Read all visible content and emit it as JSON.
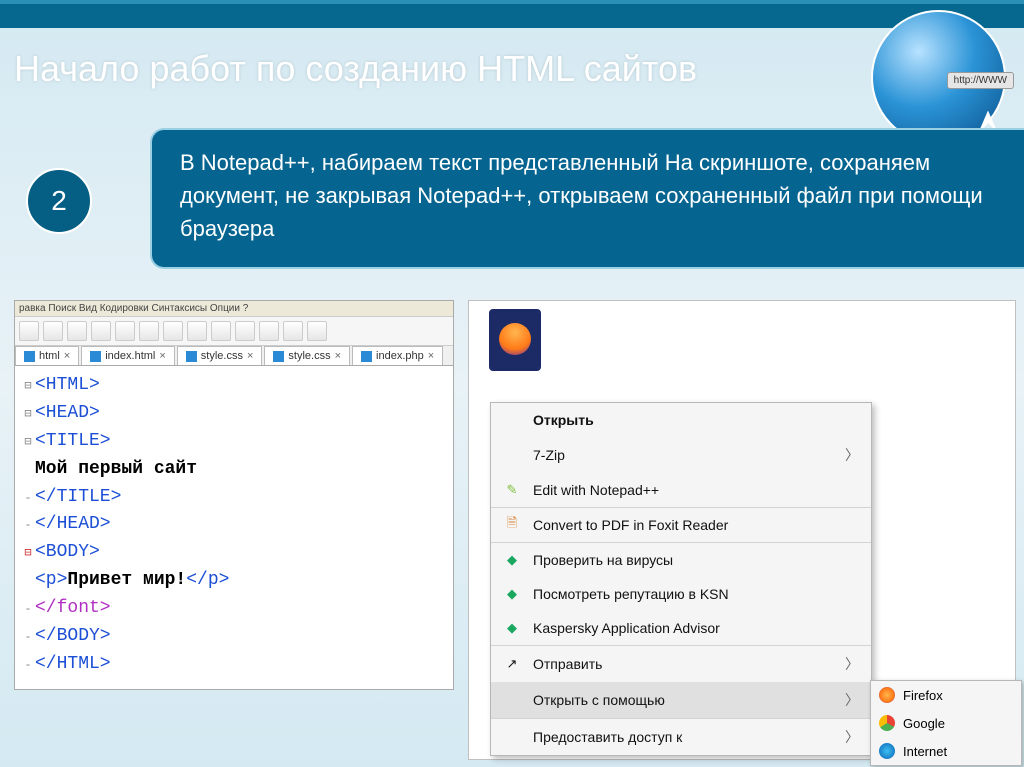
{
  "slide": {
    "title": "Начало работ по созданию HTML сайтов",
    "stepNumber": "2",
    "description": "В Notepad++, набираем текст представленный На скриншоте, сохраняем документ, не закрывая Notepad++, открываем сохраненный файл при помощи браузера",
    "globeLabel": "http://WWW"
  },
  "editor": {
    "menubar": "равка   Поиск   Вид   Кодировки   Синтаксисы   Опции   ?",
    "tabs": [
      "html",
      "index.html",
      "style.css",
      "style.css",
      "index.php"
    ],
    "code": {
      "l1": "<HTML>",
      "l2": "<HEAD>",
      "l3": "<TITLE>",
      "l4": "Мой первый сайт",
      "l5": "</TITLE>",
      "l6": "</HEAD>",
      "l7": "<BODY>",
      "l8a": "<p>",
      "l8b": "Привет мир!",
      "l8c": "</p>",
      "l9": "</font>",
      "l10": "</BODY>",
      "l11": "</HTML>"
    }
  },
  "contextMenu": {
    "open": "Открыть",
    "sevenzip": "7-Zip",
    "editNpp": "Edit with Notepad++",
    "convertPdf": "Convert to PDF in Foxit Reader",
    "scanVirus": "Проверить на вирусы",
    "ksnRep": "Посмотреть репутацию в KSN",
    "kaspAdvisor": "Kaspersky Application Advisor",
    "send": "Отправить",
    "openWith": "Открыть с помощью",
    "grantAccess": "Предоставить доступ к"
  },
  "submenu": {
    "firefox": "Firefox",
    "google": "Google",
    "internet": "Internet"
  }
}
